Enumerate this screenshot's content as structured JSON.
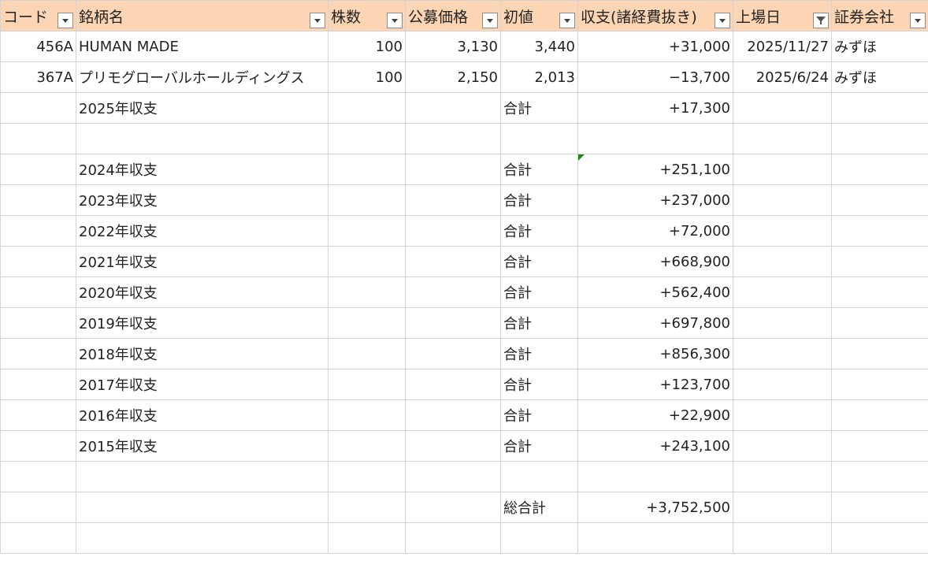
{
  "header": {
    "code": "コード",
    "name": "銘柄名",
    "shares": "株数",
    "offer_price": "公募価格",
    "first_price": "初値",
    "pnl": "収支(諸経費抜き)",
    "listing_date": "上場日",
    "broker": "証券会社"
  },
  "stocks": [
    {
      "code": "456A",
      "name": "HUMAN MADE",
      "shares": "100",
      "offer_price": "3,130",
      "first_price": "3,440",
      "pnl": "+31,000",
      "listing_date": "2025/11/27",
      "broker": "みずほ"
    },
    {
      "code": "367A",
      "name": "プリモグローバルホールディングス",
      "shares": "100",
      "offer_price": "2,150",
      "first_price": "2,013",
      "pnl": "−13,700",
      "listing_date": "2025/6/24",
      "broker": "みずほ"
    }
  ],
  "total_label": "合計",
  "year_rows": [
    {
      "label": "2025年収支",
      "total": "+17,300"
    },
    {
      "label": "2024年収支",
      "total": "+251,100"
    },
    {
      "label": "2023年収支",
      "total": "+237,000"
    },
    {
      "label": "2022年収支",
      "total": "+72,000"
    },
    {
      "label": "2021年収支",
      "total": "+668,900"
    },
    {
      "label": "2020年収支",
      "total": "+562,400"
    },
    {
      "label": "2019年収支",
      "total": "+697,800"
    },
    {
      "label": "2018年収支",
      "total": "+856,300"
    },
    {
      "label": "2017年収支",
      "total": "+123,700"
    },
    {
      "label": "2016年収支",
      "total": "+22,900"
    },
    {
      "label": "2015年収支",
      "total": "+243,100"
    }
  ],
  "grand_total": {
    "label": "総合計",
    "value": "+3,752,500"
  }
}
